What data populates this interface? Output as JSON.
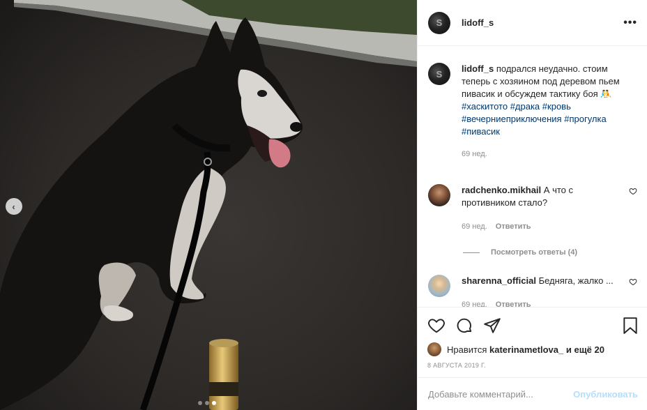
{
  "post": {
    "username": "lidoff_s",
    "more_label": "•••",
    "avatar_glyph": "S",
    "caption_text": "подрался неудачно. стоим теперь с хозяином под деревом пьем пивасик и обсуждем тактику боя 🤼",
    "hashtags": [
      "#хаскитото",
      "#драка",
      "#кровь",
      "#вечерниеприключения",
      "#прогулка",
      "#пивасик"
    ],
    "caption_time": "69 нед."
  },
  "comments": [
    {
      "username": "radchenko.mikhail",
      "text": "А что с противником стало?",
      "time": "69 нед.",
      "reply_label": "Ответить",
      "view_replies": "Посмотреть ответы (4)"
    },
    {
      "username": "sharenna_official",
      "text": "Бедняга, жалко ...",
      "time": "69 нед.",
      "reply_label": "Ответить"
    }
  ],
  "actions": {
    "icons": [
      "heart-icon",
      "comment-icon",
      "share-icon",
      "bookmark-icon"
    ],
    "likes_prefix": "Нравится",
    "likes_user": "katerinametlova_",
    "likes_suffix": "и ещё 20",
    "date": "8 августа 2019 г."
  },
  "add_comment": {
    "placeholder": "Добавьте комментарий...",
    "post_label": "Опубликовать"
  },
  "carousel": {
    "total": 3,
    "active_index": 2
  },
  "colors": {
    "hashtag": "#00376b",
    "muted": "#8e8e8e",
    "post_disabled": "#b2dffc",
    "border": "#efefef"
  }
}
